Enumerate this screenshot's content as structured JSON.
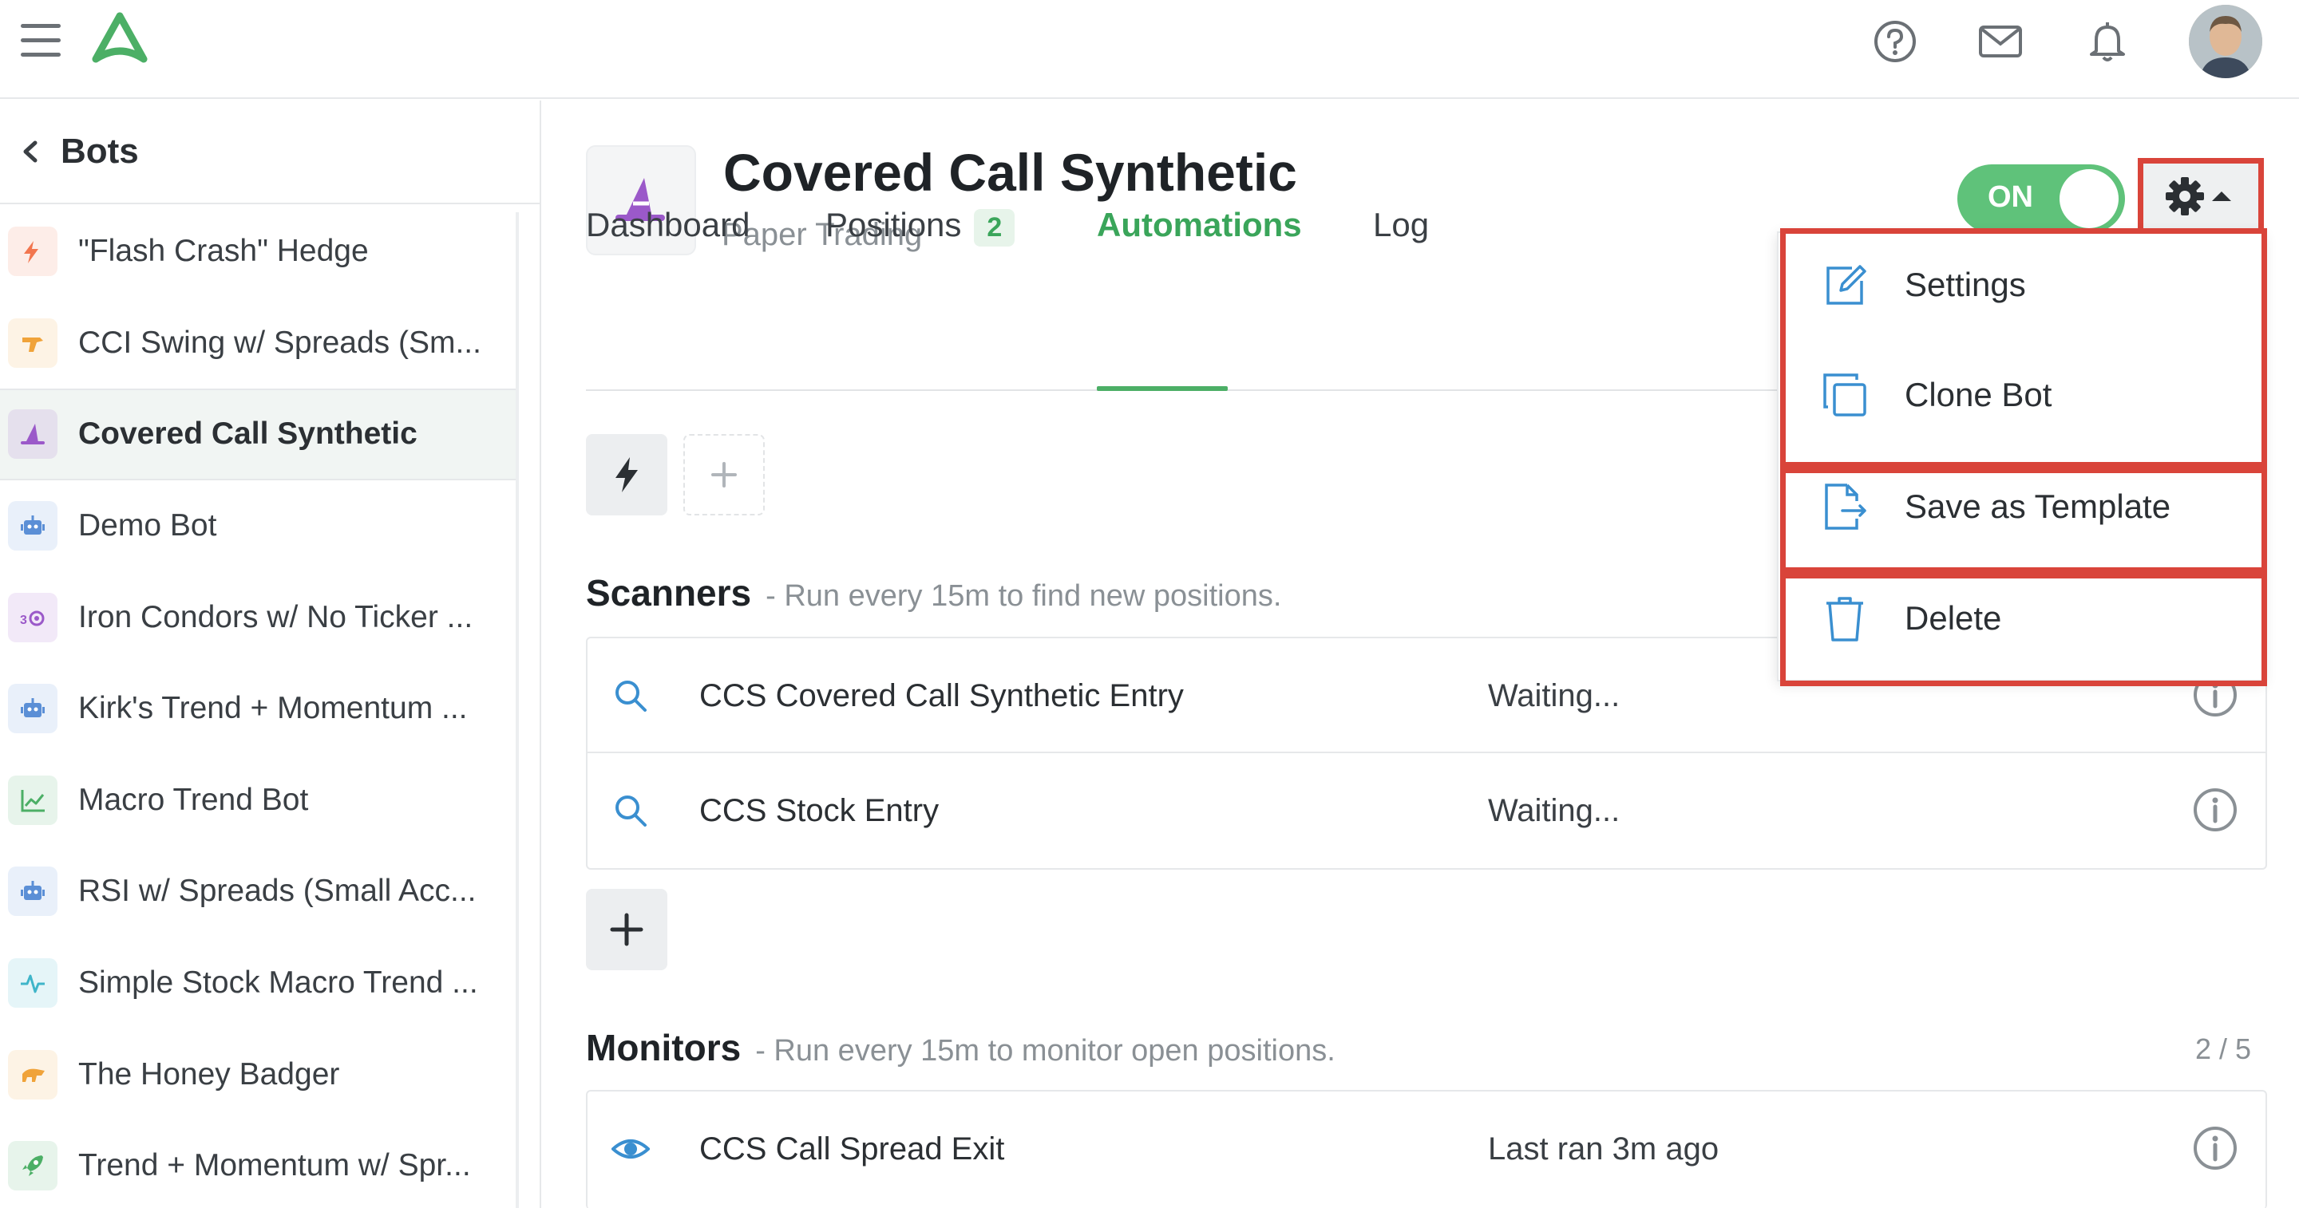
{
  "topbar": {
    "menu_icon": "hamburger-icon",
    "logo_icon": "app-logo-icon",
    "icons": [
      "help-icon",
      "mail-icon",
      "bell-icon"
    ],
    "avatar": "user-avatar"
  },
  "sidebar": {
    "title": "Bots",
    "items": [
      {
        "label": "\"Flash Crash\" Hedge",
        "icon": "lightning-icon",
        "color": "#f2764f"
      },
      {
        "label": "CCI Swing w/ Spreads (Sm...",
        "icon": "blaster-icon",
        "color": "#f0a33a"
      },
      {
        "label": "Covered Call Synthetic",
        "icon": "wizard-hat-icon",
        "color": "#9b59c9"
      },
      {
        "label": "Demo Bot",
        "icon": "robot-icon",
        "color": "#5b8fd6"
      },
      {
        "label": "Iron Condors w/ No Ticker ...",
        "icon": "condor-icon",
        "color": "#9b59c9"
      },
      {
        "label": "Kirk's Trend + Momentum ...",
        "icon": "robot-icon",
        "color": "#5b8fd6"
      },
      {
        "label": "Macro Trend Bot",
        "icon": "trend-chart-icon",
        "color": "#4caf66"
      },
      {
        "label": "RSI w/ Spreads (Small Acc...",
        "icon": "robot-icon",
        "color": "#5b8fd6"
      },
      {
        "label": "Simple Stock Macro Trend ...",
        "icon": "pulse-icon",
        "color": "#3fb5c9"
      },
      {
        "label": "The Honey Badger",
        "icon": "badger-icon",
        "color": "#f0a33a"
      },
      {
        "label": "Trend + Momentum w/ Spr...",
        "icon": "rocket-icon",
        "color": "#4caf66"
      }
    ]
  },
  "bot": {
    "title": "Covered Call Synthetic",
    "subtitle": "Paper Trading",
    "toggle_label": "ON"
  },
  "tabs": [
    {
      "label": "Dashboard"
    },
    {
      "label": "Positions",
      "badge": "2"
    },
    {
      "label": "Automations"
    },
    {
      "label": "Log"
    }
  ],
  "scanners": {
    "title": "Scanners",
    "desc": "- Run every 15m to find new positions.",
    "rows": [
      {
        "name": "CCS Covered Call Synthetic Entry",
        "status": "Waiting..."
      },
      {
        "name": "CCS Stock Entry",
        "status": "Waiting..."
      }
    ]
  },
  "monitors": {
    "title": "Monitors",
    "desc": "- Run every 15m to monitor open positions.",
    "count": "2 / 5",
    "rows": [
      {
        "name": "CCS Call Spread Exit",
        "status": "Last ran 3m ago"
      }
    ]
  },
  "dropdown": {
    "items": [
      {
        "label": "Settings",
        "icon": "edit-icon"
      },
      {
        "label": "Clone Bot",
        "icon": "copy-icon"
      },
      {
        "label": "Save as Template",
        "icon": "export-file-icon"
      },
      {
        "label": "Delete",
        "icon": "trash-icon"
      }
    ]
  },
  "colors": {
    "accent": "#4caf66",
    "highlight": "#d9443a"
  }
}
